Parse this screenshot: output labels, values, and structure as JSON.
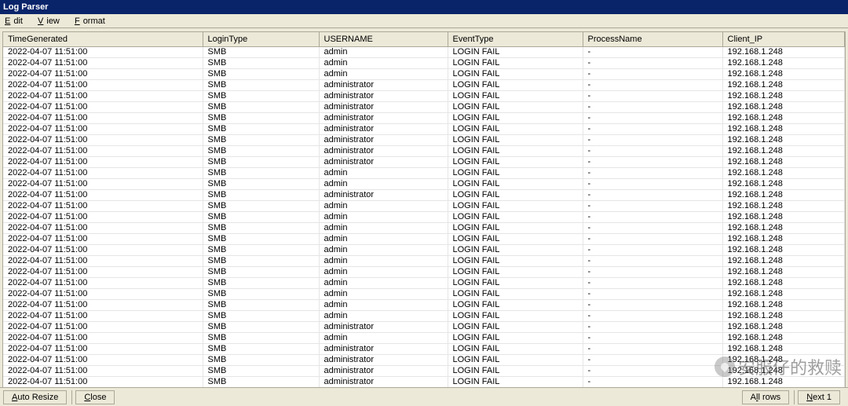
{
  "title": "Log Parser",
  "menu": {
    "edit": "Edit",
    "view": "View",
    "format": "Format"
  },
  "columns": {
    "time": "TimeGenerated",
    "login": "LoginType",
    "user": "USERNAME",
    "event": "EventType",
    "proc": "ProcessName",
    "ip": "Client_IP"
  },
  "rows": [
    {
      "time": "2022-04-07 11:51:00",
      "login": "SMB",
      "user": "admin",
      "event": "LOGIN FAIL",
      "proc": "-",
      "ip": "192.168.1.248"
    },
    {
      "time": "2022-04-07 11:51:00",
      "login": "SMB",
      "user": "admin",
      "event": "LOGIN FAIL",
      "proc": "-",
      "ip": "192.168.1.248"
    },
    {
      "time": "2022-04-07 11:51:00",
      "login": "SMB",
      "user": "admin",
      "event": "LOGIN FAIL",
      "proc": "-",
      "ip": "192.168.1.248"
    },
    {
      "time": "2022-04-07 11:51:00",
      "login": "SMB",
      "user": "administrator",
      "event": "LOGIN FAIL",
      "proc": "-",
      "ip": "192.168.1.248"
    },
    {
      "time": "2022-04-07 11:51:00",
      "login": "SMB",
      "user": "administrator",
      "event": "LOGIN FAIL",
      "proc": "-",
      "ip": "192.168.1.248"
    },
    {
      "time": "2022-04-07 11:51:00",
      "login": "SMB",
      "user": "administrator",
      "event": "LOGIN FAIL",
      "proc": "-",
      "ip": "192.168.1.248"
    },
    {
      "time": "2022-04-07 11:51:00",
      "login": "SMB",
      "user": "administrator",
      "event": "LOGIN FAIL",
      "proc": "-",
      "ip": "192.168.1.248"
    },
    {
      "time": "2022-04-07 11:51:00",
      "login": "SMB",
      "user": "administrator",
      "event": "LOGIN FAIL",
      "proc": "-",
      "ip": "192.168.1.248"
    },
    {
      "time": "2022-04-07 11:51:00",
      "login": "SMB",
      "user": "administrator",
      "event": "LOGIN FAIL",
      "proc": "-",
      "ip": "192.168.1.248"
    },
    {
      "time": "2022-04-07 11:51:00",
      "login": "SMB",
      "user": "administrator",
      "event": "LOGIN FAIL",
      "proc": "-",
      "ip": "192.168.1.248"
    },
    {
      "time": "2022-04-07 11:51:00",
      "login": "SMB",
      "user": "administrator",
      "event": "LOGIN FAIL",
      "proc": "-",
      "ip": "192.168.1.248"
    },
    {
      "time": "2022-04-07 11:51:00",
      "login": "SMB",
      "user": "admin",
      "event": "LOGIN FAIL",
      "proc": "-",
      "ip": "192.168.1.248"
    },
    {
      "time": "2022-04-07 11:51:00",
      "login": "SMB",
      "user": "admin",
      "event": "LOGIN FAIL",
      "proc": "-",
      "ip": "192.168.1.248"
    },
    {
      "time": "2022-04-07 11:51:00",
      "login": "SMB",
      "user": "administrator",
      "event": "LOGIN FAIL",
      "proc": "-",
      "ip": "192.168.1.248"
    },
    {
      "time": "2022-04-07 11:51:00",
      "login": "SMB",
      "user": "admin",
      "event": "LOGIN FAIL",
      "proc": "-",
      "ip": "192.168.1.248"
    },
    {
      "time": "2022-04-07 11:51:00",
      "login": "SMB",
      "user": "admin",
      "event": "LOGIN FAIL",
      "proc": "-",
      "ip": "192.168.1.248"
    },
    {
      "time": "2022-04-07 11:51:00",
      "login": "SMB",
      "user": "admin",
      "event": "LOGIN FAIL",
      "proc": "-",
      "ip": "192.168.1.248"
    },
    {
      "time": "2022-04-07 11:51:00",
      "login": "SMB",
      "user": "admin",
      "event": "LOGIN FAIL",
      "proc": "-",
      "ip": "192.168.1.248"
    },
    {
      "time": "2022-04-07 11:51:00",
      "login": "SMB",
      "user": "admin",
      "event": "LOGIN FAIL",
      "proc": "-",
      "ip": "192.168.1.248"
    },
    {
      "time": "2022-04-07 11:51:00",
      "login": "SMB",
      "user": "admin",
      "event": "LOGIN FAIL",
      "proc": "-",
      "ip": "192.168.1.248"
    },
    {
      "time": "2022-04-07 11:51:00",
      "login": "SMB",
      "user": "admin",
      "event": "LOGIN FAIL",
      "proc": "-",
      "ip": "192.168.1.248"
    },
    {
      "time": "2022-04-07 11:51:00",
      "login": "SMB",
      "user": "admin",
      "event": "LOGIN FAIL",
      "proc": "-",
      "ip": "192.168.1.248"
    },
    {
      "time": "2022-04-07 11:51:00",
      "login": "SMB",
      "user": "admin",
      "event": "LOGIN FAIL",
      "proc": "-",
      "ip": "192.168.1.248"
    },
    {
      "time": "2022-04-07 11:51:00",
      "login": "SMB",
      "user": "admin",
      "event": "LOGIN FAIL",
      "proc": "-",
      "ip": "192.168.1.248"
    },
    {
      "time": "2022-04-07 11:51:00",
      "login": "SMB",
      "user": "admin",
      "event": "LOGIN FAIL",
      "proc": "-",
      "ip": "192.168.1.248"
    },
    {
      "time": "2022-04-07 11:51:00",
      "login": "SMB",
      "user": "administrator",
      "event": "LOGIN FAIL",
      "proc": "-",
      "ip": "192.168.1.248"
    },
    {
      "time": "2022-04-07 11:51:00",
      "login": "SMB",
      "user": "admin",
      "event": "LOGIN FAIL",
      "proc": "-",
      "ip": "192.168.1.248"
    },
    {
      "time": "2022-04-07 11:51:00",
      "login": "SMB",
      "user": "administrator",
      "event": "LOGIN FAIL",
      "proc": "-",
      "ip": "192.168.1.248"
    },
    {
      "time": "2022-04-07 11:51:00",
      "login": "SMB",
      "user": "administrator",
      "event": "LOGIN FAIL",
      "proc": "-",
      "ip": "192.168.1.248"
    },
    {
      "time": "2022-04-07 11:51:00",
      "login": "SMB",
      "user": "administrator",
      "event": "LOGIN FAIL",
      "proc": "-",
      "ip": "192.168.1.248"
    },
    {
      "time": "2022-04-07 11:51:00",
      "login": "SMB",
      "user": "administrator",
      "event": "LOGIN FAIL",
      "proc": "-",
      "ip": "192.168.1.248"
    }
  ],
  "footer": {
    "auto_resize": "Auto Resize",
    "close": "Close",
    "all_rows": "All rows",
    "next": "Next 1"
  },
  "watermark": "安服仔的救赎"
}
